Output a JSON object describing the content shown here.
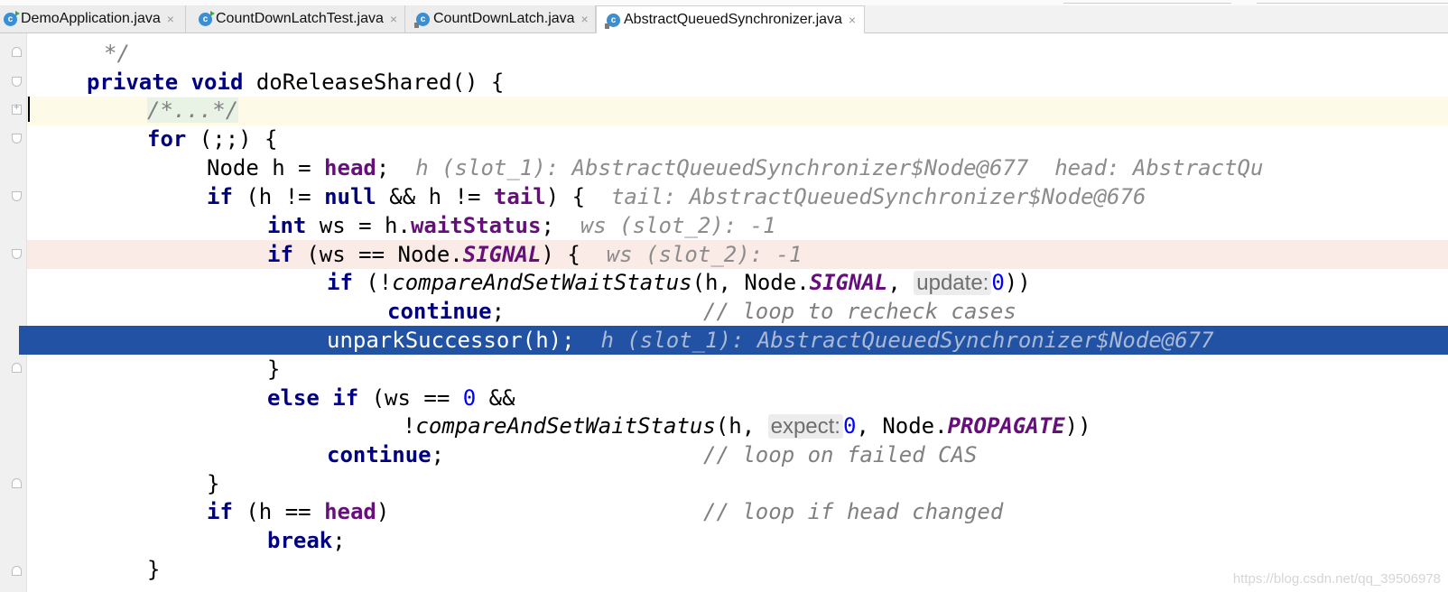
{
  "tabs": [
    {
      "label": "DemoApplication.java",
      "icon": "class-run-icon"
    },
    {
      "label": "CountDownLatchTest.java",
      "icon": "class-run-icon"
    },
    {
      "label": "CountDownLatch.java",
      "icon": "class-library-icon"
    },
    {
      "label": "AbstractQueuedSynchronizer.java",
      "icon": "class-library-icon",
      "active": true
    }
  ],
  "tab_close_glyph": "×",
  "code": {
    "l0": "*/",
    "l1_kw": "private void",
    "l1_rest": " doReleaseShared() {",
    "l2_fold": "/*...*/",
    "l3_kw": "for",
    "l3_rest": " (;;) {",
    "l4_type": "Node h = ",
    "l4_fld": "head",
    "l4_semi": ";",
    "l4_inline": "h (slot_1): AbstractQueuedSynchronizer$Node@677  head: AbstractQu",
    "l5_kw": "if",
    "l5_a": " (h != ",
    "l5_null": "null",
    "l5_b": " && h != ",
    "l5_tail": "tail",
    "l5_c": ") {",
    "l5_inline": "tail: AbstractQueuedSynchronizer$Node@676",
    "l6_kw": "int",
    "l6_a": " ws = h.",
    "l6_fld": "waitStatus",
    "l6_semi": ";",
    "l6_inline": "ws (slot_2): -1",
    "l7_kw": "if",
    "l7_a": " (ws == Node.",
    "l7_sfld": "SIGNAL",
    "l7_b": ") {",
    "l7_inline": "ws (slot_2): -1",
    "l8_kw": "if",
    "l8_a": " (!",
    "l8_meth": "compareAndSetWaitStatus",
    "l8_b": "(h, Node.",
    "l8_sfld": "SIGNAL",
    "l8_c": ", ",
    "l8_hint": "update:",
    "l8_num": "0",
    "l8_d": "))",
    "l9_kw": "continue",
    "l9_semi": ";",
    "l9_cmt": "// loop to recheck cases",
    "l10_text": "unparkSuccessor(h);",
    "l10_inline": "h (slot_1): AbstractQueuedSynchronizer$Node@677",
    "l11": "}",
    "l12_kw": "else if",
    "l12_a": " (ws == ",
    "l12_num": "0",
    "l12_b": " &&",
    "l13_a": "!",
    "l13_meth": "compareAndSetWaitStatus",
    "l13_b": "(h, ",
    "l13_hint": "expect:",
    "l13_num": "0",
    "l13_c": ", Node.",
    "l13_sfld": "PROPAGATE",
    "l13_d": "))",
    "l14_kw": "continue",
    "l14_semi": ";",
    "l14_cmt": "// loop on failed CAS",
    "l15": "}",
    "l16_kw": "if",
    "l16_a": " (h == ",
    "l16_fld": "head",
    "l16_b": ")",
    "l16_cmt": "// loop if head changed",
    "l17_kw": "break",
    "l17_semi": ";",
    "l18": "}"
  },
  "watermark": "https://blog.csdn.net/qq_39506978",
  "colors": {
    "keyword": "#000080",
    "field": "#660e7a",
    "number": "#0000ff",
    "comment": "#808080",
    "execution_line": "#2152a3",
    "breakpoint_line": "#faebe7",
    "caret_line": "#fdfbe8"
  }
}
